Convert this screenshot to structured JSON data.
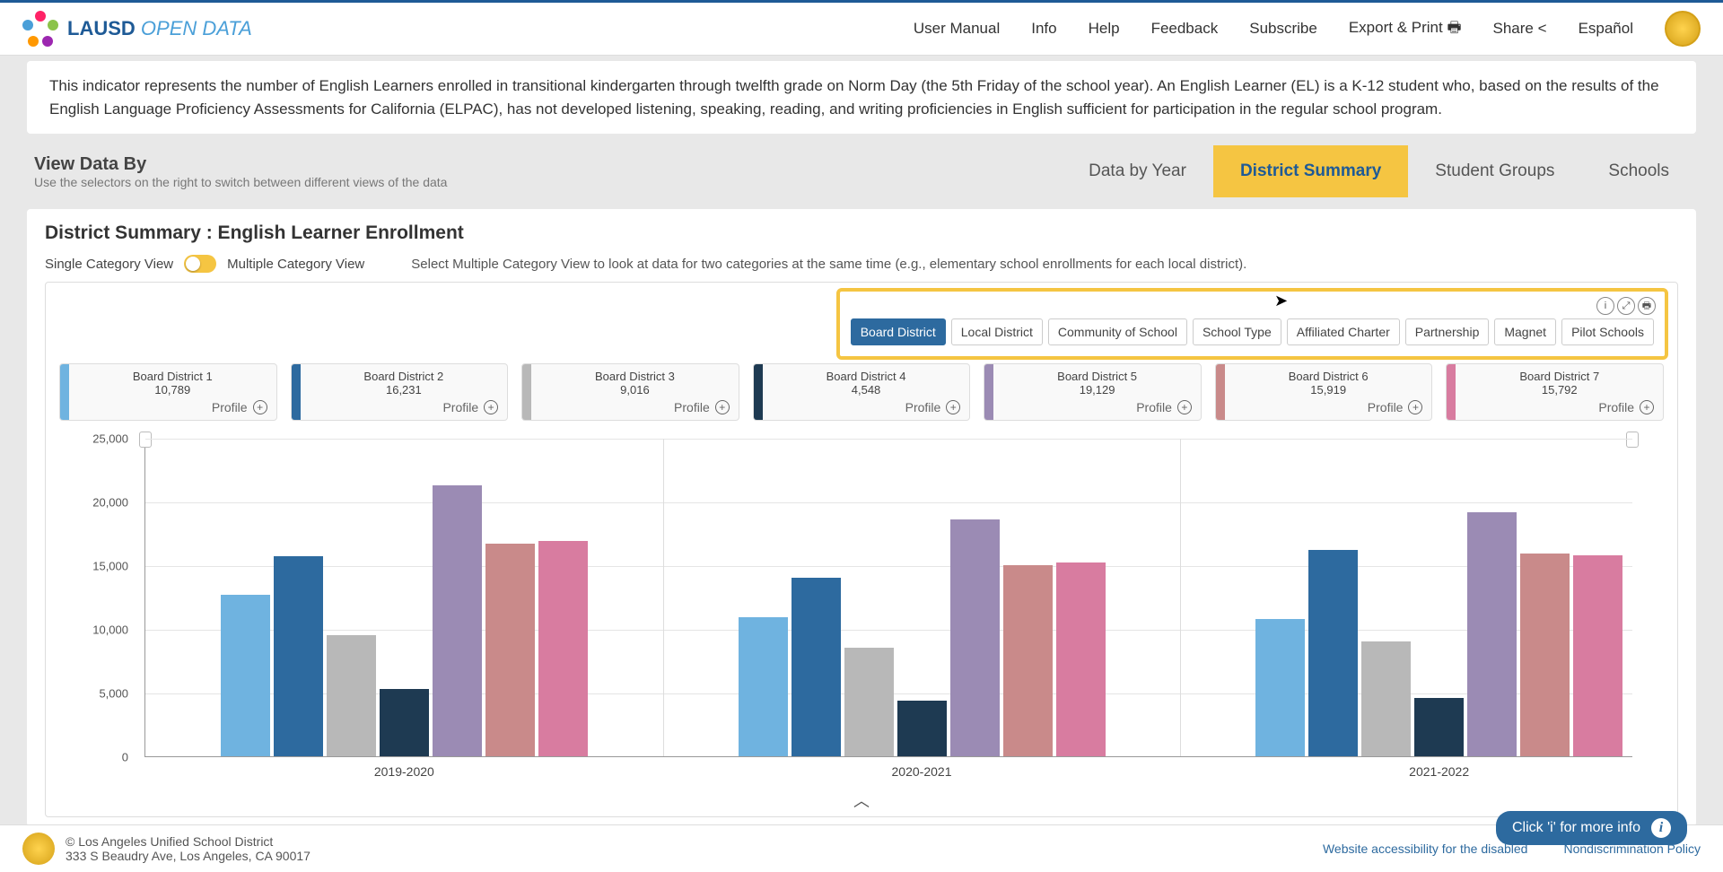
{
  "header": {
    "logo_bold": "LAUSD",
    "logo_light": "OPEN DATA",
    "nav": [
      "User Manual",
      "Info",
      "Help",
      "Feedback",
      "Subscribe",
      "Export & Print",
      "Share",
      "Español"
    ]
  },
  "description": "This indicator represents the number of English Learners enrolled in transitional kindergarten through twelfth grade on Norm Day (the 5th Friday of the school year). An English Learner (EL) is a K-12 student who, based on the results of the English Language Proficiency Assessments for California (ELPAC), has not developed listening, speaking, reading, and writing proficiencies in English sufficient for participation in the regular school program.",
  "view": {
    "title": "View Data By",
    "sub": "Use the selectors on the right to switch between different views of the data",
    "tabs": [
      "Data by Year",
      "District Summary",
      "Student Groups",
      "Schools"
    ],
    "active_tab": 1
  },
  "panel": {
    "title": "District Summary : English Learner Enrollment",
    "toggle_left": "Single Category View",
    "toggle_right": "Multiple Category View",
    "toggle_hint": "Select Multiple Category View to look at data for two categories at the same time (e.g., elementary school enrollments for each local district)."
  },
  "filters": [
    "Board District",
    "Local District",
    "Community of School",
    "School Type",
    "Affiliated Charter",
    "Partnership",
    "Magnet",
    "Pilot Schools"
  ],
  "cards": [
    {
      "name": "Board District 1",
      "value": "10,789",
      "color": "#6fb3e0"
    },
    {
      "name": "Board District 2",
      "value": "16,231",
      "color": "#2d6a9f"
    },
    {
      "name": "Board District 3",
      "value": "9,016",
      "color": "#b8b8b8"
    },
    {
      "name": "Board District 4",
      "value": "4,548",
      "color": "#1e3a52"
    },
    {
      "name": "Board District 5",
      "value": "19,129",
      "color": "#9b8bb4"
    },
    {
      "name": "Board District 6",
      "value": "15,919",
      "color": "#c98a8a"
    },
    {
      "name": "Board District 7",
      "value": "15,792",
      "color": "#d87ca0"
    }
  ],
  "profile_label": "Profile",
  "chart_data": {
    "type": "bar",
    "title": "",
    "xlabel": "",
    "ylabel": "",
    "ylim": [
      0,
      25000
    ],
    "y_ticks": [
      0,
      5000,
      10000,
      15000,
      20000,
      25000
    ],
    "y_tick_labels": [
      "0",
      "5,000",
      "10,000",
      "15,000",
      "20,000",
      "25,000"
    ],
    "categories": [
      "2019-2020",
      "2020-2021",
      "2021-2022"
    ],
    "series": [
      {
        "name": "Board District 1",
        "color": "#6fb3e0",
        "values": [
          12700,
          10900,
          10789
        ]
      },
      {
        "name": "Board District 2",
        "color": "#2d6a9f",
        "values": [
          15700,
          14000,
          16231
        ]
      },
      {
        "name": "Board District 3",
        "color": "#b8b8b8",
        "values": [
          9500,
          8500,
          9016
        ]
      },
      {
        "name": "Board District 4",
        "color": "#1e3a52",
        "values": [
          5300,
          4400,
          4548
        ]
      },
      {
        "name": "Board District 5",
        "color": "#9b8bb4",
        "values": [
          21300,
          18600,
          19129
        ]
      },
      {
        "name": "Board District 6",
        "color": "#c98a8a",
        "values": [
          16700,
          15000,
          15919
        ]
      },
      {
        "name": "Board District 7",
        "color": "#d87ca0",
        "values": [
          16900,
          15200,
          15792
        ]
      }
    ]
  },
  "info_pill": "Click 'i' for more info",
  "footer": {
    "org": "© Los Angeles Unified School District",
    "addr": "333 S Beaudry Ave, Los Angeles, CA 90017",
    "links": [
      "Website accessibility for the disabled",
      "Nondiscrimination Policy"
    ]
  }
}
